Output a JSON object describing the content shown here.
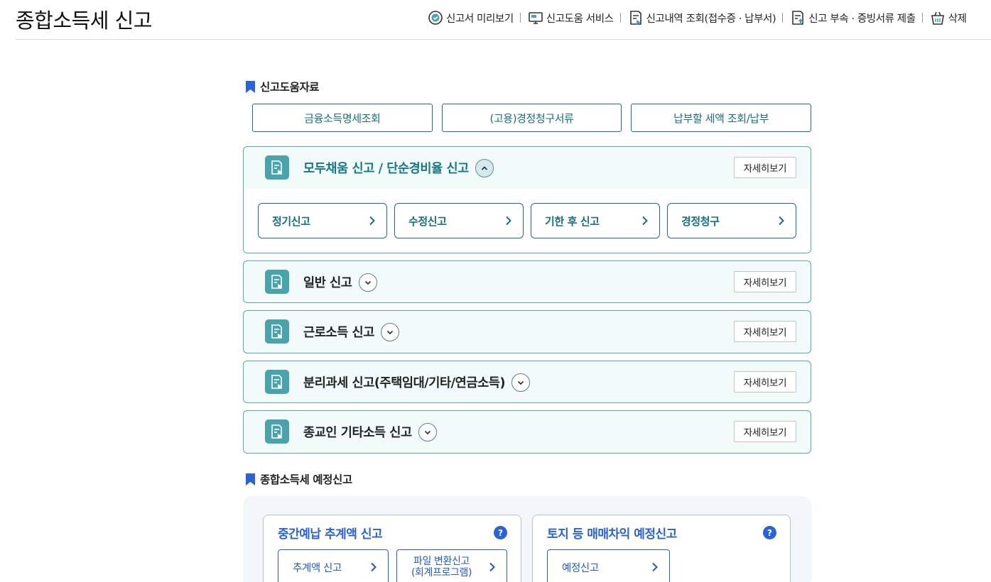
{
  "page": {
    "title": "종합소득세 신고"
  },
  "top_nav": [
    {
      "label": "신고서 미리보기",
      "icon": "preview-check-icon"
    },
    {
      "label": "신고도움 서비스",
      "icon": "monitor-help-icon"
    },
    {
      "label": "신고내역 조회(접수증 · 납부서)",
      "icon": "history-doc-icon"
    },
    {
      "label": "신고 부속 · 증빙서류 제출",
      "icon": "upload-doc-icon"
    },
    {
      "label": "삭제",
      "icon": "trash-basket-icon"
    }
  ],
  "help_section": {
    "heading": "신고도움자료",
    "buttons": [
      "금융소득명세조회",
      "(고용)경정청구서류",
      "납부할 세액 조회/납부"
    ]
  },
  "panels": [
    {
      "title": "모두채움 신고 / 단순경비율 신고",
      "expanded": true,
      "detail_label": "자세히보기",
      "sub_buttons": [
        "정기신고",
        "수정신고",
        "기한 후 신고",
        "경정청구"
      ]
    },
    {
      "title": "일반 신고",
      "expanded": false,
      "detail_label": "자세히보기"
    },
    {
      "title": "근로소득 신고",
      "expanded": false,
      "detail_label": "자세히보기"
    },
    {
      "title": "분리과세 신고(주택임대/기타/연금소득)",
      "expanded": false,
      "detail_label": "자세히보기"
    },
    {
      "title": "종교인 기타소득 신고",
      "expanded": false,
      "detail_label": "자세히보기"
    }
  ],
  "estimate_section": {
    "heading": "종합소득세 예정신고",
    "cards": [
      {
        "title": "중간예납 추계액 신고",
        "help": "?",
        "buttons": [
          {
            "label": "추계액 신고"
          },
          {
            "line1": "파일 변환신고",
            "line2": "(회계프로그램)"
          }
        ]
      },
      {
        "title": "토지 등 매매차익 예정신고",
        "help": "?",
        "buttons": [
          {
            "label": "예정신고"
          }
        ]
      }
    ]
  },
  "colors": {
    "teal": "#1a6f7b",
    "panel_bg": "#f2fafa",
    "blue": "#2962d6",
    "bookmark": "#2b63d6"
  }
}
